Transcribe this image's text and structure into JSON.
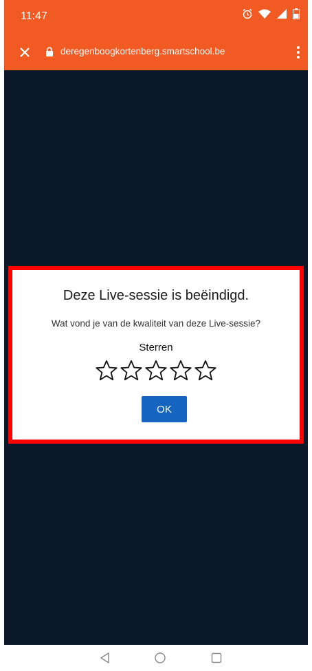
{
  "status_bar": {
    "time": "11:47",
    "icons": [
      "alarm-icon",
      "wifi-icon",
      "signal-icon",
      "battery-icon"
    ]
  },
  "url_bar": {
    "url": "deregenboogkortenberg.smartschool.be"
  },
  "dialog": {
    "title": "Deze Live-sessie is beëindigd.",
    "question": "Wat vond je van de kwaliteit van deze Live-sessie?",
    "stars_label": "Sterren",
    "rating": {
      "value": 0,
      "max": 5
    },
    "ok_label": "OK"
  },
  "colors": {
    "accent": "#f25a24",
    "background": "#0b1829",
    "button": "#1565c0",
    "highlight": "#ff0000"
  }
}
